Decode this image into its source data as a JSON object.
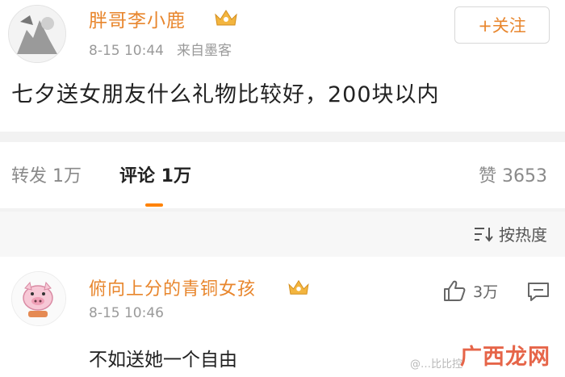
{
  "post": {
    "username": "胖哥李小鹿",
    "time": "8-15 10:44",
    "source": "来自墨客",
    "follow_label": "+关注",
    "text": "七夕送女朋友什么礼物比较好，200块以内"
  },
  "tabs": {
    "repost": "转发 1万",
    "comments": "评论 1万",
    "likes": "赞 3653"
  },
  "sort": {
    "label": "按热度"
  },
  "comment": {
    "username": "俯向上分的青铜女孩",
    "time": "8-15 10:46",
    "text": "不如送她一个自由",
    "likes": "3万"
  },
  "watermark": {
    "handle": "@…比比控",
    "site": "广西龙网"
  },
  "colors": {
    "accent": "#e8862d",
    "tab_indicator": "#ff8200"
  },
  "icons": [
    "crown-icon",
    "sort-icon",
    "thumbs-up-icon",
    "comment-reply-icon"
  ]
}
